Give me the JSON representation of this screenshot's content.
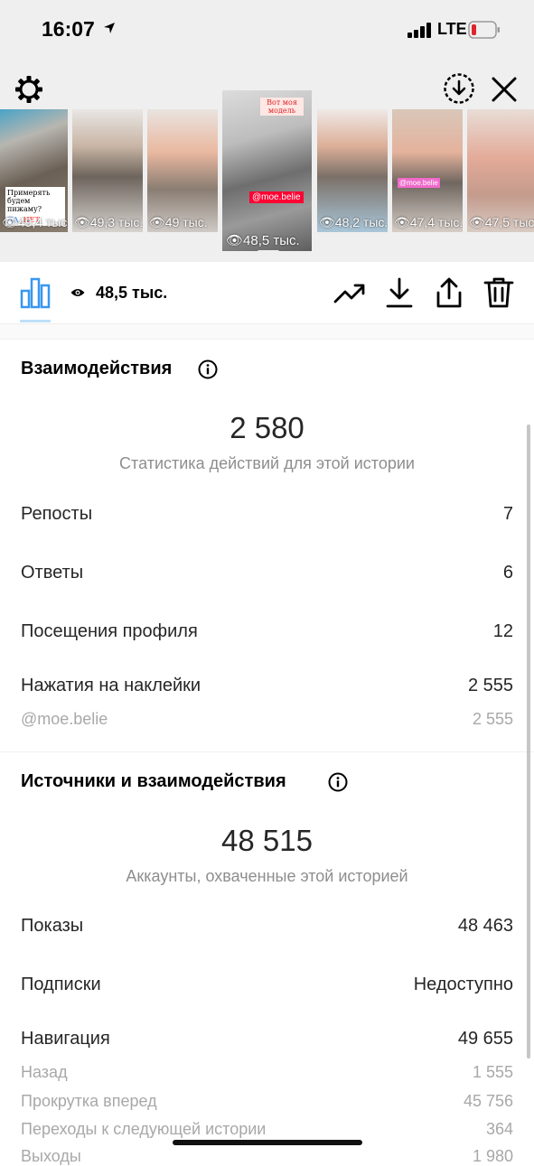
{
  "status_bar": {
    "time": "16:07",
    "network": "LTE"
  },
  "stories": [
    {
      "views": "49,4 тыс.",
      "caption": "Примерять будем пижаму?",
      "poll_yes": "ДА",
      "poll_no": "НЕТ"
    },
    {
      "views": "49,3 тыс."
    },
    {
      "views": "49 тыс."
    },
    {
      "views": "48,5 тыс.",
      "selected": true,
      "header": "Вот моя модель",
      "mention": "@moe.belie"
    },
    {
      "views": "48,2 тыс."
    },
    {
      "views": "47,4 тыс.",
      "mention": "@moe.belie"
    },
    {
      "views": "47,5 тыс."
    }
  ],
  "toolbar": {
    "views": "48,5 тыс."
  },
  "interactions": {
    "title": "Взаимодействия",
    "total": "2 580",
    "subtitle": "Статистика действий для этой истории",
    "rows": [
      {
        "label": "Репосты",
        "value": "7"
      },
      {
        "label": "Ответы",
        "value": "6"
      },
      {
        "label": "Посещения профиля",
        "value": "12"
      },
      {
        "label": "Нажатия на наклейки",
        "value": "2 555"
      }
    ],
    "sub_rows": [
      {
        "label": "@moe.belie",
        "value": "2 555"
      }
    ]
  },
  "sources": {
    "title": "Источники и взаимодействия",
    "total": "48 515",
    "subtitle": "Аккаунты, охваченные этой историей",
    "rows": [
      {
        "label": "Показы",
        "value": "48 463"
      },
      {
        "label": "Подписки",
        "value": "Недоступно"
      },
      {
        "label": "Навигация",
        "value": "49 655"
      }
    ],
    "sub_rows": [
      {
        "label": "Назад",
        "value": "1 555"
      },
      {
        "label": "Прокрутка вперед",
        "value": "45 756"
      },
      {
        "label": "Переходы к следующей истории",
        "value": "364"
      },
      {
        "label": "Выходы",
        "value": "1 980"
      }
    ]
  },
  "icons": [
    "gear-icon",
    "download-circle-icon",
    "close-icon",
    "bar-chart-icon",
    "eye-icon",
    "trend-icon",
    "download-icon",
    "share-icon",
    "trash-icon",
    "info-icon"
  ],
  "colors": {
    "tab_underline": "#bfe0f8",
    "mention_tag": "#ff0033",
    "panel_bg": "#efefef",
    "secondary_text": "#8e8e8e"
  }
}
